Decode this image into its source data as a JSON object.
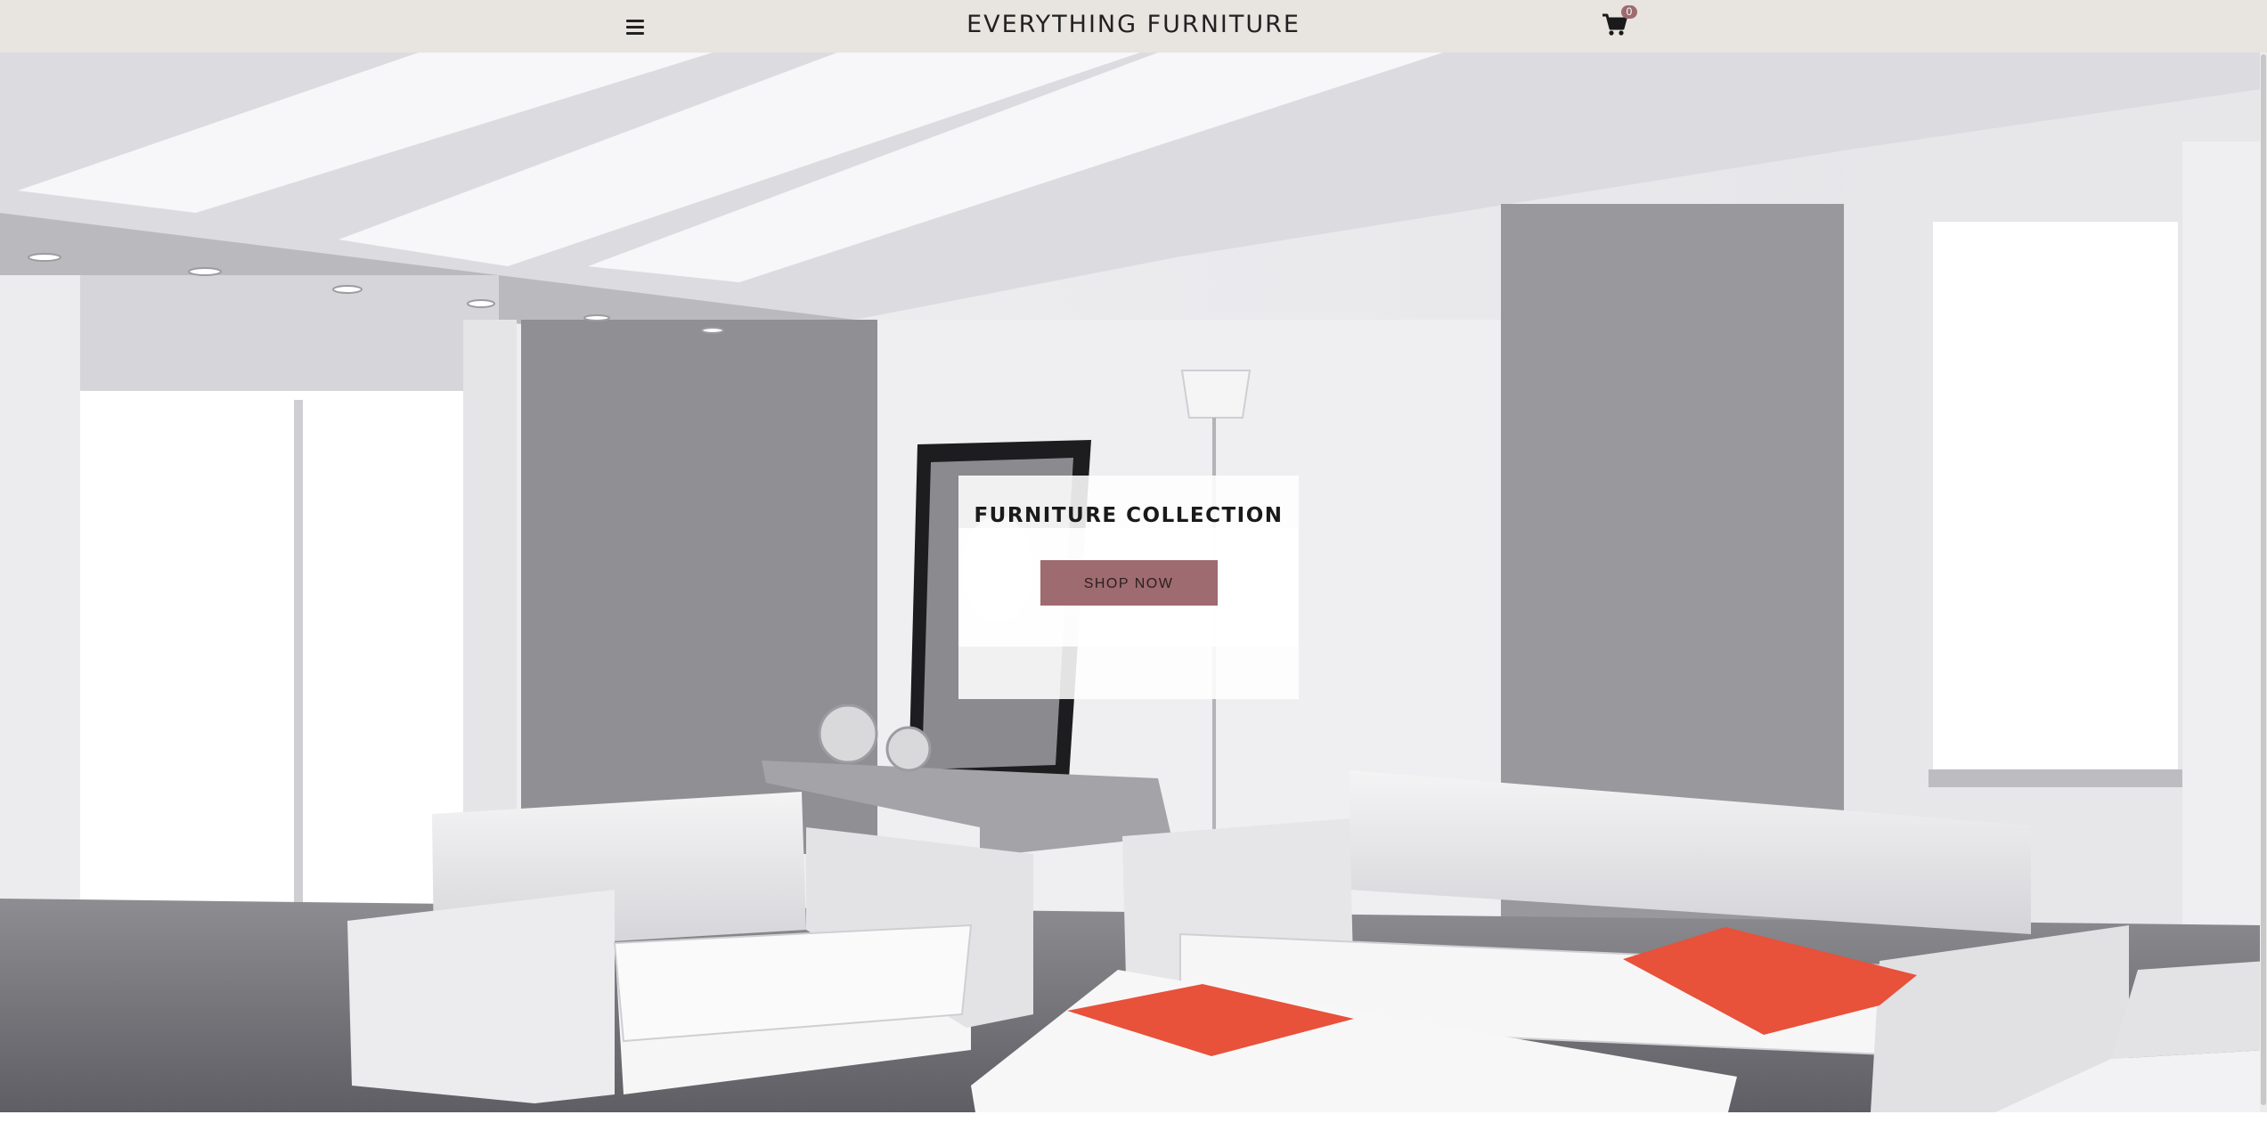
{
  "header": {
    "brand": "EVERYTHING FURNITURE",
    "menu_icon": "hamburger-menu-icon",
    "cart_icon": "shopping-cart-icon",
    "cart_count": "0"
  },
  "hero": {
    "title": "FURNITURE COLLECTION",
    "button_label": "SHOP NOW",
    "image": "living-room-photo"
  },
  "colors": {
    "header_bg": "#e8e4e0",
    "accent": "#9e6b70",
    "pillow_accent": "#e8513a"
  }
}
